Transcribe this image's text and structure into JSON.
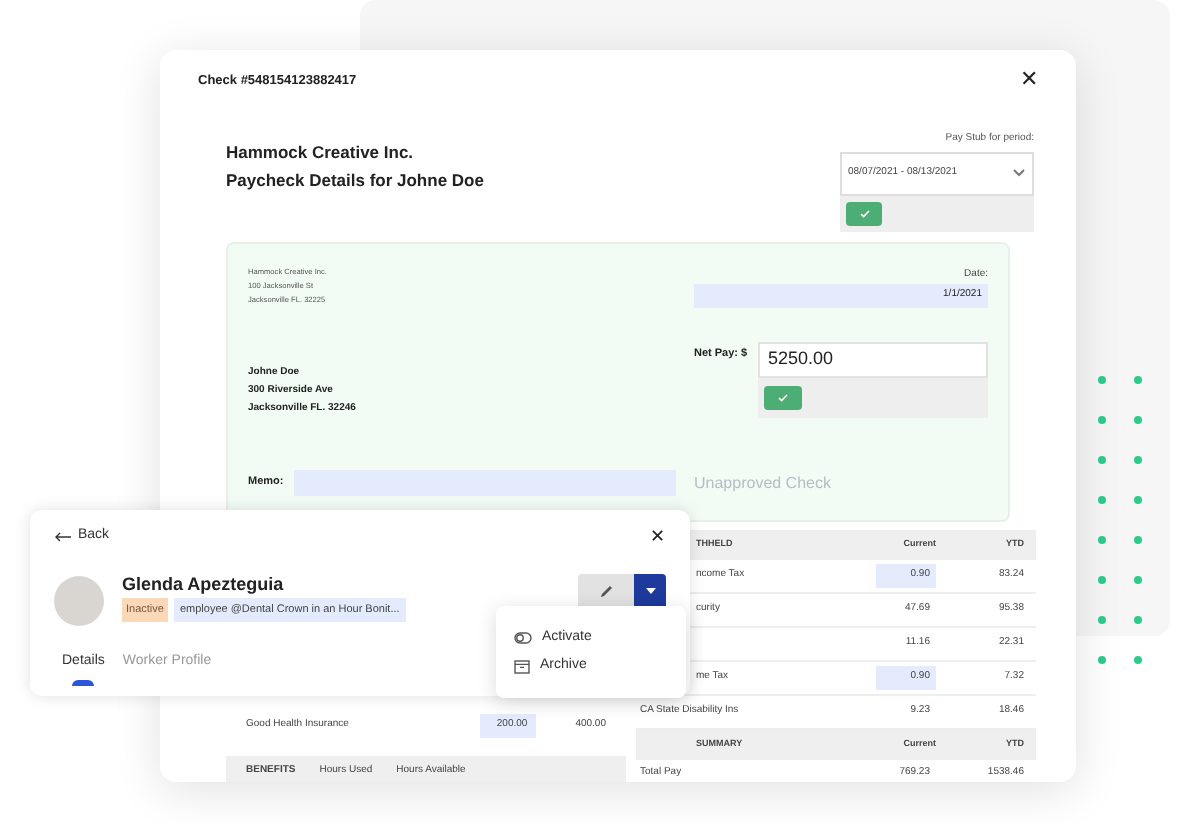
{
  "check_window": {
    "title": "Check #548154123882417",
    "close": "✕",
    "heading_lines": [
      "Hammock Creative Inc.",
      "Paycheck Details for Johne Doe"
    ],
    "pay_stub": {
      "label": "Pay Stub for period:",
      "value": "08/07/2021 - 08/13/2021"
    },
    "check": {
      "company_lines": [
        "Hammock Creative Inc.",
        "100 Jacksonville St",
        "Jacksonville FL. 32225"
      ],
      "date_label": "Date:",
      "date": "1/1/2021",
      "payee_lines": [
        "Johne Doe",
        "300 Riverside Ave",
        "Jacksonville FL. 32246"
      ],
      "net_pay_label": "Net Pay: $",
      "net_pay": "5250.00",
      "memo_label": "Memo:",
      "status": "Unapproved Check"
    },
    "deductions_row": {
      "label": "Good Health Insurance",
      "current": "200.00",
      "ytd": "400.00"
    },
    "benefits_header": [
      "BENEFITS",
      "Hours Used",
      "Hours Available"
    ],
    "withheld_table": {
      "columns": [
        "THHELD",
        "Current",
        "YTD"
      ],
      "rows": [
        {
          "label": "ncome Tax",
          "current": "0.90",
          "ytd": "83.24",
          "highlighted": true
        },
        {
          "label": "curity",
          "current": "47.69",
          "ytd": "95.38",
          "highlighted": false
        },
        {
          "current": "11.16",
          "ytd": "22.31",
          "highlighted": false
        },
        {
          "label": "me Tax",
          "current": "0.90",
          "ytd": "7.32",
          "highlighted": true
        },
        {
          "label": "CA State Disability Ins",
          "current": "9.23",
          "ytd": "18.46",
          "highlighted": false
        }
      ]
    },
    "summary_table": {
      "columns": [
        "SUMMARY",
        "Current",
        "YTD"
      ],
      "rows": [
        {
          "label": "Total Pay",
          "current": "769.23",
          "ytd": "1538.46"
        }
      ]
    }
  },
  "worker_card": {
    "back": "Back",
    "close": "✕",
    "name": "Glenda Apezteguia",
    "status_badge": "Inactive",
    "role": "employee @Dental Crown in an Hour Bonit...",
    "tabs": [
      {
        "label": "Details",
        "selected": true
      },
      {
        "label": "Worker Profile",
        "selected": false
      }
    ],
    "menu": [
      {
        "kind": "activate",
        "label": "Activate"
      },
      {
        "kind": "archive",
        "label": "Archive"
      }
    ]
  }
}
